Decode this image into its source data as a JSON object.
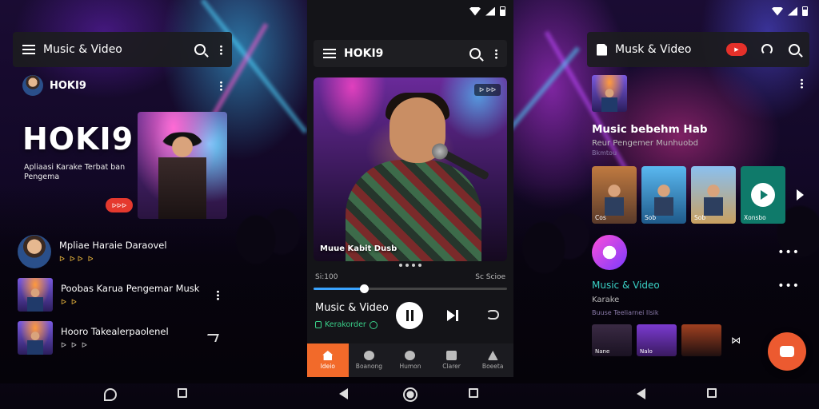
{
  "left": {
    "appbar_title": "Music & Video",
    "profile_name": "HOKI9",
    "hero_title": "HOKI9",
    "hero_subtitle": "Apliaasi Karake Terbat ban Pengema",
    "hero_badge": "ᐅᐅᐅ",
    "items": [
      {
        "title": "Mpliae Haraie Daraovel",
        "meta": [
          "ᐅ",
          "ᐅ ᐅ",
          "ᐅ"
        ]
      },
      {
        "title": "Poobas Karua Pengemar Musk",
        "meta": [
          "ᐅ",
          "ᐅ"
        ]
      },
      {
        "title": "Hooro Takealerpaolenel",
        "meta": [
          "ᐅ",
          "ᐅ",
          "ᐅ"
        ]
      }
    ]
  },
  "center": {
    "appbar_title": "HOKI9",
    "video_badge": "ᐅ ᐅᐅ",
    "video_caption": "Muue Kabit Dusb",
    "time_left": "Si:100",
    "time_right": "Sc Scioe",
    "progress": 0.26,
    "now_playing_title": "Music & Video",
    "now_playing_sub": "Kerakorder",
    "nav": [
      {
        "label": "Ideio"
      },
      {
        "label": "Boanong"
      },
      {
        "label": "Humon"
      },
      {
        "label": "Clarer"
      },
      {
        "label": "Boeeta"
      }
    ]
  },
  "right": {
    "appbar_title": "Musk & Video",
    "section_title": "Music bebehm Hab",
    "section_sub": "Reur Pengemer Munhuobd",
    "section_sub2": "Bkmtou",
    "cards": [
      {
        "label": "Cos"
      },
      {
        "label": "Sob"
      },
      {
        "label": "Sob"
      },
      {
        "label": "Xonsbo"
      }
    ],
    "feature_title": "Music & Video",
    "feature_sub": "Karake",
    "feature_sub2": "Buuse Teeliarnei Ilsik",
    "minis": [
      {
        "label": "Nane"
      },
      {
        "label": "Nalo"
      },
      {
        "label": ""
      }
    ]
  },
  "colors": {
    "accent_orange": "#f26a2a",
    "accent_teal": "#3ad2c6",
    "progress_blue": "#3aa4ff",
    "badge_red": "#e5302a"
  }
}
